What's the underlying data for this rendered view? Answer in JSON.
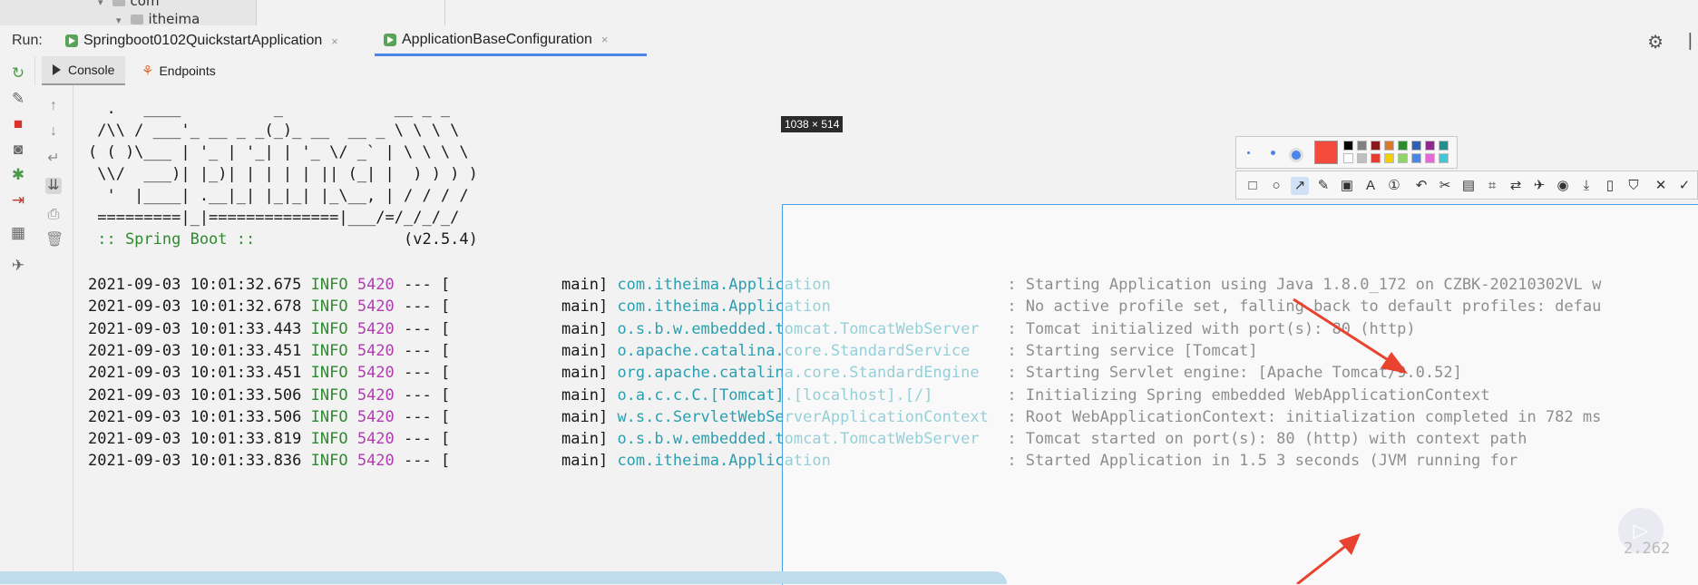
{
  "tree": {
    "items": [
      {
        "label": "com"
      },
      {
        "label": "itheima"
      }
    ]
  },
  "run_bar": {
    "label": "Run:",
    "tabs": [
      {
        "label": "Springboot0102QuickstartApplication",
        "close": "×"
      },
      {
        "label": "ApplicationBaseConfiguration",
        "close": "×"
      }
    ]
  },
  "sub_tabs": {
    "console": "Console",
    "endpoints": "Endpoints"
  },
  "banner": [
    "  .   ____          _            __ _ _",
    " /\\\\ / ___'_ __ _ _(_)_ __  __ _ \\ \\ \\ \\",
    "( ( )\\___ | '_ | '_| | '_ \\/ _` | \\ \\ \\ \\",
    " \\\\/  ___)| |_)| | | | | || (_| |  ) ) ) )",
    "  '  |____| .__|_| |_|_| |_\\__, | / / / /",
    " =========|_|==============|___/=/_/_/_/"
  ],
  "spring_line": {
    "label": " :: Spring Boot ::",
    "version": "(v2.5.4)"
  },
  "logs": [
    {
      "ts": "2021-09-03 10:01:32.675",
      "level": "INFO",
      "pid": "5420",
      "sep": "--- [",
      "thread": "           main]",
      "logger": "com.itheima.Application",
      "msg": ": Starting Application using Java 1.8.0_172 on CZBK-20210302VL w"
    },
    {
      "ts": "2021-09-03 10:01:32.678",
      "level": "INFO",
      "pid": "5420",
      "sep": "--- [",
      "thread": "           main]",
      "logger": "com.itheima.Application",
      "msg": ": No active profile set, falling back to default profiles: defau"
    },
    {
      "ts": "2021-09-03 10:01:33.443",
      "level": "INFO",
      "pid": "5420",
      "sep": "--- [",
      "thread": "           main]",
      "logger": "o.s.b.w.embedded.tomcat.TomcatWebServer",
      "msg": ": Tomcat initialized with port(s): 80 (http)"
    },
    {
      "ts": "2021-09-03 10:01:33.451",
      "level": "INFO",
      "pid": "5420",
      "sep": "--- [",
      "thread": "           main]",
      "logger": "o.apache.catalina.core.StandardService",
      "msg": ": Starting service [Tomcat]"
    },
    {
      "ts": "2021-09-03 10:01:33.451",
      "level": "INFO",
      "pid": "5420",
      "sep": "--- [",
      "thread": "           main]",
      "logger": "org.apache.catalina.core.StandardEngine",
      "msg": ": Starting Servlet engine: [Apache Tomcat/9.0.52]"
    },
    {
      "ts": "2021-09-03 10:01:33.506",
      "level": "INFO",
      "pid": "5420",
      "sep": "--- [",
      "thread": "           main]",
      "logger": "o.a.c.c.C.[Tomcat].[localhost].[/]",
      "msg": ": Initializing Spring embedded WebApplicationContext"
    },
    {
      "ts": "2021-09-03 10:01:33.506",
      "level": "INFO",
      "pid": "5420",
      "sep": "--- [",
      "thread": "           main]",
      "logger": "w.s.c.ServletWebServerApplicationContext",
      "msg": ": Root WebApplicationContext: initialization completed in 782 ms"
    },
    {
      "ts": "2021-09-03 10:01:33.819",
      "level": "INFO",
      "pid": "5420",
      "sep": "--- [",
      "thread": "           main]",
      "logger": "o.s.b.w.embedded.tomcat.TomcatWebServer",
      "msg": ": Tomcat started on port(s): 80 (http) with context path"
    },
    {
      "ts": "2021-09-03 10:01:33.836",
      "level": "INFO",
      "pid": "5420",
      "sep": "--- [",
      "thread": "           main]",
      "logger": "com.itheima.Application",
      "msg": ": Started Application in 1.5 3 seconds (JVM running for"
    }
  ],
  "capture": {
    "size_label": "1038 × 514"
  },
  "player": {
    "speed": "2.262"
  },
  "colors": {
    "accent": "#4a86e8",
    "arrow": "#e8432e",
    "logger": "#2a9fb0",
    "pid": "#b23cb2",
    "info": "#2e8b2e"
  }
}
